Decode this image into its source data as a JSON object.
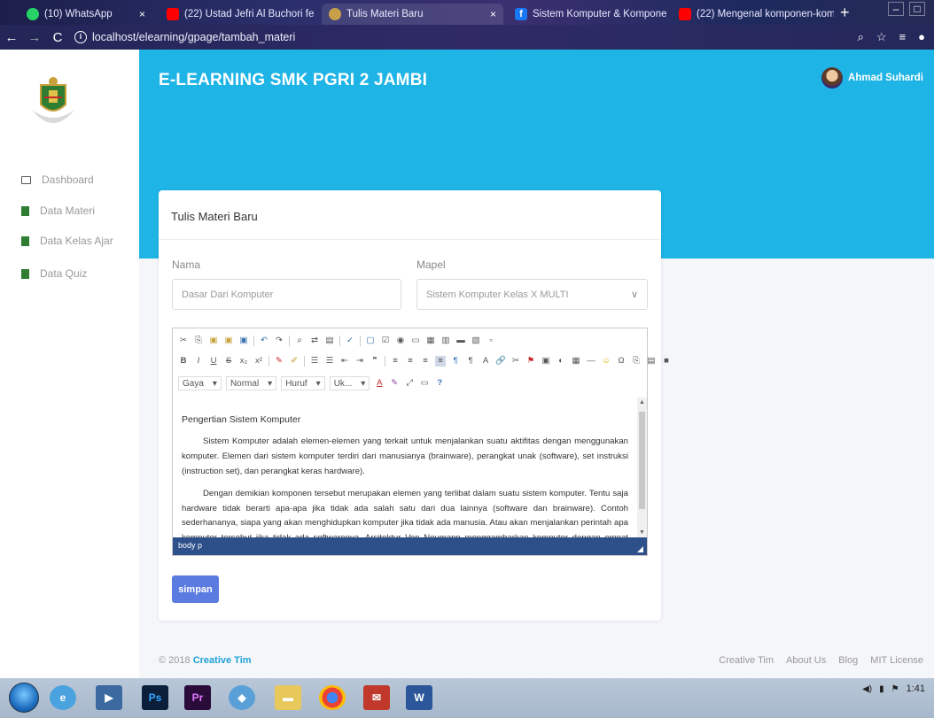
{
  "browser": {
    "tabs": [
      {
        "label": "(10) WhatsApp",
        "icon": "whatsapp-icon",
        "active": false
      },
      {
        "label": "(22) Ustad Jefri Al Buchori fe",
        "icon": "youtube-icon",
        "active": false
      },
      {
        "label": "Tulis Materi Baru",
        "icon": "site-favicon",
        "active": true
      },
      {
        "label": "Sistem Komputer & Komponen",
        "icon": "facebook-icon",
        "active": false
      },
      {
        "label": "(22) Mengenal komponen-komp",
        "icon": "youtube-icon",
        "active": false
      }
    ],
    "url": "localhost/elearning/gpage/tambah_materi"
  },
  "sidebar": {
    "items": [
      {
        "label": "Dashboard",
        "icon": "monitor-icon"
      },
      {
        "label": "Data Materi",
        "icon": "book-icon"
      },
      {
        "label": "Data Kelas Ajar",
        "icon": "book-icon"
      },
      {
        "label": "Data Quiz",
        "icon": "book-icon"
      }
    ]
  },
  "header": {
    "brand": "E-LEARNING SMK PGRI 2 JAMBI",
    "user_name": "Ahmad Suhardi",
    "color": "#1fb4e6"
  },
  "form": {
    "title": "Tulis Materi Baru",
    "nama_label": "Nama",
    "nama_placeholder": "Dasar Dari Komputer",
    "mapel_label": "Mapel",
    "mapel_value": "Sistem Komputer Kelas X MULTI",
    "submit_label": "simpan"
  },
  "editor": {
    "combos": {
      "style": "Gaya",
      "format": "Normal",
      "font": "Huruf",
      "size": "Uk..."
    },
    "heading": "Pengertian Sistem Komputer",
    "paragraphs": [
      "Sistem Komputer adalah elemen-elemen yang terkait untuk menjalankan suatu aktifitas dengan menggunakan komputer. Elemen dari sistem komputer terdiri dari manusianya (brainware), perangkat unak (software), set instruksi (instruction set), dan perangkat keras hardware).",
      "Dengan demikian komponen tersebut merupakan elemen yang terlibat dalam suatu sistem komputer. Tentu saja hardware tidak berarti apa-apa jika tidak ada salah satu dari dua lainnya (software dan brainware). Contoh sederhananya, siapa yang akan menghidupkan komputer jika tidak ada manusia. Atau akan menjalankan perintah apa komputer tersebut jika tidak ada softwarenya. Arsitektur Von Neumann menggambarkan komputer dengan empat bagian utama: Unit Aritmatika dan Logis (ALU), unit kontrol, memori, dan alat masukan dan hasil (secara kolektif dinamakan I/O). Bagian ini dihubungkan oleh berkas kawat \"bus\"."
    ],
    "path": "body  p"
  },
  "footer": {
    "copyright": "© 2018",
    "brand_link": "Creative Tim",
    "links": [
      "Creative Tim",
      "About Us",
      "Blog",
      "MIT License"
    ]
  },
  "taskbar": {
    "time": "1:41",
    "apps": [
      "Ps",
      "Pr",
      "Chrome",
      "W"
    ]
  }
}
